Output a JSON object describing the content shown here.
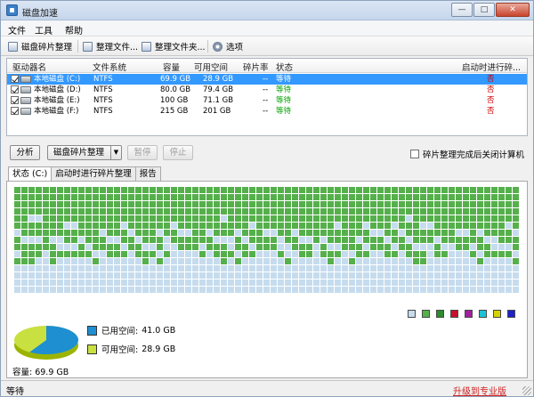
{
  "window": {
    "title": "磁盘加速",
    "btn_minimize": "—",
    "btn_maximize": "□",
    "btn_close": "✕"
  },
  "menu": {
    "items": [
      "文件",
      "工具",
      "帮助"
    ]
  },
  "toolbar": {
    "defrag": "磁盘碎片整理",
    "defrag_files": "整理文件...",
    "defrag_folders": "整理文件夹...",
    "options": "选项"
  },
  "list": {
    "columns": [
      "驱动器名",
      "文件系统",
      "容量",
      "可用空间",
      "碎片率",
      "状态",
      "启动时进行碎..."
    ],
    "rows": [
      {
        "name": "本地磁盘 (C:)",
        "fs": "NTFS",
        "capacity": "69.9 GB",
        "free": "28.9 GB",
        "frag": "--",
        "status": "等待",
        "boot": "否",
        "selected": true
      },
      {
        "name": "本地磁盘 (D:)",
        "fs": "NTFS",
        "capacity": "80.0 GB",
        "free": "79.4 GB",
        "frag": "--",
        "status": "等待",
        "boot": "否",
        "selected": false
      },
      {
        "name": "本地磁盘 (E:)",
        "fs": "NTFS",
        "capacity": "100 GB",
        "free": "71.1 GB",
        "frag": "--",
        "status": "等待",
        "boot": "否",
        "selected": false
      },
      {
        "name": "本地磁盘 (F:)",
        "fs": "NTFS",
        "capacity": "215 GB",
        "free": "201 GB",
        "frag": "--",
        "status": "等待",
        "boot": "否",
        "selected": false
      }
    ]
  },
  "controls": {
    "analyze": "分析",
    "defrag": "磁盘碎片整理",
    "pause": "暂停",
    "stop": "停止",
    "shutdown_after": "碎片整理完成后关闭计算机"
  },
  "tabs": [
    "状态 (C:)",
    "启动时进行碎片整理",
    "报告"
  ],
  "disk_map": {
    "colors": {
      "used": "#55b04b",
      "free": "#c6dcee"
    },
    "legend_colors": [
      "#c6dcee",
      "#55b04b",
      "#2e8b2e",
      "#c8102e",
      "#a020a0",
      "#19c3d3",
      "#d4d400",
      "#2020c8"
    ]
  },
  "capacity": {
    "used_label": "已用空间:",
    "used_value": "41.0 GB",
    "free_label": "可用空间:",
    "free_value": "28.9 GB",
    "total_label": "容量: 69.9 GB",
    "used_color": "#1e8fd0",
    "free_color": "#c8e040",
    "used_fraction": 0.587
  },
  "statusbar": {
    "text": "等待",
    "upgrade": "升级到专业版"
  }
}
